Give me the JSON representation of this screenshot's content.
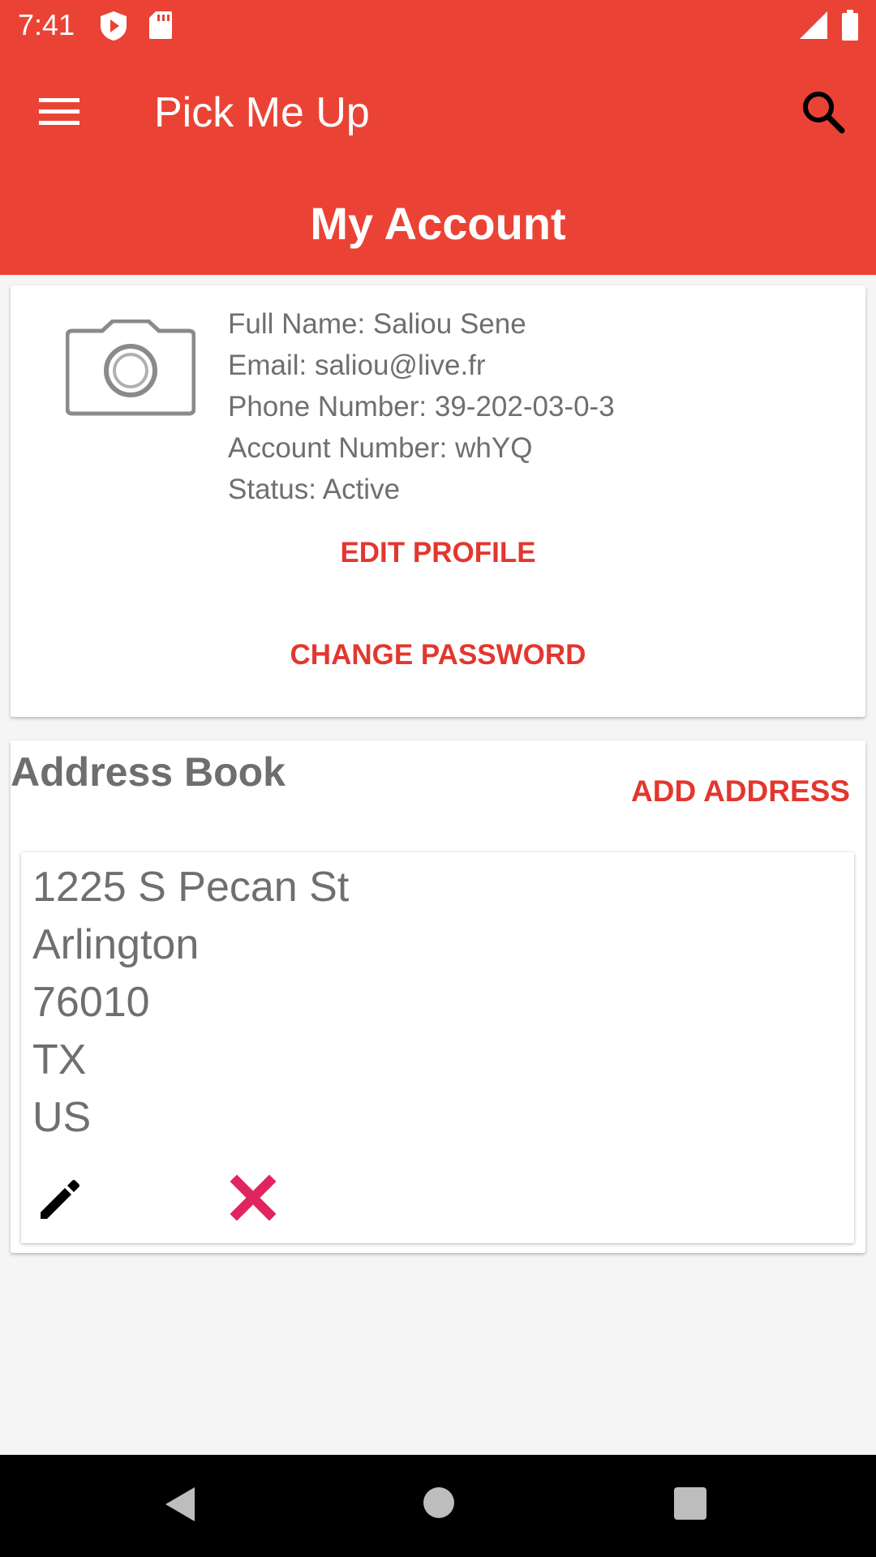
{
  "status_bar": {
    "time": "7:41"
  },
  "app_bar": {
    "title": "Pick Me Up",
    "page_title": "My Account",
    "accent_color": "#ea4335"
  },
  "profile": {
    "full_name": "Full Name: Saliou Sene",
    "email": "Email: saliou@live.fr",
    "phone": "Phone Number: 39-202-03-0-3",
    "account_number": "Account Number: whYQ",
    "status": "Status: Active",
    "edit_profile_label": "EDIT PROFILE",
    "change_password_label": "CHANGE PASSWORD"
  },
  "address_book": {
    "title": "Address Book",
    "add_address_label": "ADD ADDRESS",
    "addresses": [
      {
        "street": "1225 S Pecan St",
        "city": "Arlington",
        "zip": "76010",
        "state": "TX",
        "country": "US"
      }
    ]
  },
  "icons": {
    "menu": "hamburger-menu-icon",
    "search": "search-icon",
    "photo": "camera-icon",
    "edit": "pencil-icon",
    "delete": "red-x-icon"
  },
  "colors": {
    "button_text": "#e2372f",
    "delete_icon": "#e0245e"
  }
}
